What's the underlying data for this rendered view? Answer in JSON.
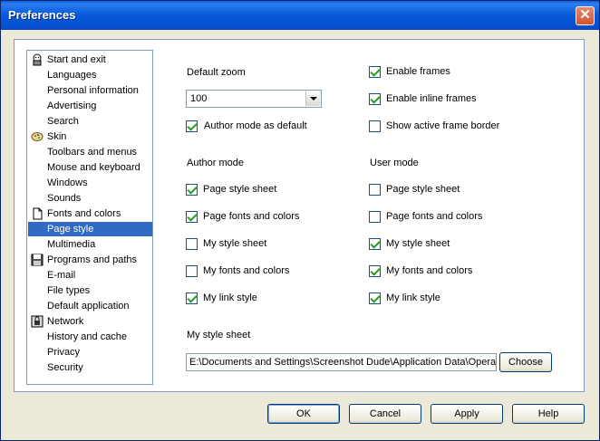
{
  "window": {
    "title": "Preferences"
  },
  "sidebar": {
    "items": [
      {
        "label": "Start and exit",
        "icon": "start-exit-icon"
      },
      {
        "label": "Languages",
        "icon": ""
      },
      {
        "label": "Personal information",
        "icon": ""
      },
      {
        "label": "Advertising",
        "icon": ""
      },
      {
        "label": "Search",
        "icon": ""
      },
      {
        "label": "Skin",
        "icon": "skin-icon"
      },
      {
        "label": "Toolbars and menus",
        "icon": ""
      },
      {
        "label": "Mouse and keyboard",
        "icon": ""
      },
      {
        "label": "Windows",
        "icon": ""
      },
      {
        "label": "Sounds",
        "icon": ""
      },
      {
        "label": "Fonts and colors",
        "icon": "document-icon"
      },
      {
        "label": "Page style",
        "icon": "",
        "selected": true
      },
      {
        "label": "Multimedia",
        "icon": ""
      },
      {
        "label": "Programs and paths",
        "icon": "floppy-disk-icon"
      },
      {
        "label": "E-mail",
        "icon": ""
      },
      {
        "label": "File types",
        "icon": ""
      },
      {
        "label": "Default application",
        "icon": ""
      },
      {
        "label": "Network",
        "icon": "network-lock-icon"
      },
      {
        "label": "History and cache",
        "icon": ""
      },
      {
        "label": "Privacy",
        "icon": ""
      },
      {
        "label": "Security",
        "icon": ""
      }
    ]
  },
  "content": {
    "default_zoom_label": "Default zoom",
    "zoom_value": "100",
    "author_mode_default": {
      "label": "Author mode as default",
      "checked": true
    },
    "frames": [
      {
        "label": "Enable frames",
        "checked": true
      },
      {
        "label": "Enable inline frames",
        "checked": true
      },
      {
        "label": "Show active frame border",
        "checked": false
      }
    ],
    "author_mode_label": "Author mode",
    "user_mode_label": "User mode",
    "author_mode": [
      {
        "label": "Page style sheet",
        "checked": true
      },
      {
        "label": "Page fonts and colors",
        "checked": true
      },
      {
        "label": "My style sheet",
        "checked": false
      },
      {
        "label": "My fonts and colors",
        "checked": false
      },
      {
        "label": "My link style",
        "checked": true
      }
    ],
    "user_mode": [
      {
        "label": "Page style sheet",
        "checked": false
      },
      {
        "label": "Page fonts and colors",
        "checked": false
      },
      {
        "label": "My style sheet",
        "checked": true
      },
      {
        "label": "My fonts and colors",
        "checked": true
      },
      {
        "label": "My link style",
        "checked": true
      }
    ],
    "my_style_sheet_label": "My style sheet",
    "style_sheet_path": "E:\\Documents and Settings\\Screenshot Dude\\Application Data\\Opera\\Opera\\styles\\user.css",
    "choose_label": "Choose"
  },
  "footer": {
    "ok_label": "OK",
    "cancel_label": "Cancel",
    "apply_label": "Apply",
    "help_label": "Help"
  },
  "colors": {
    "title_bar": "#0758d8",
    "selection": "#316ac5",
    "checkmark": "#21a121",
    "close_button": "#d3512f"
  }
}
